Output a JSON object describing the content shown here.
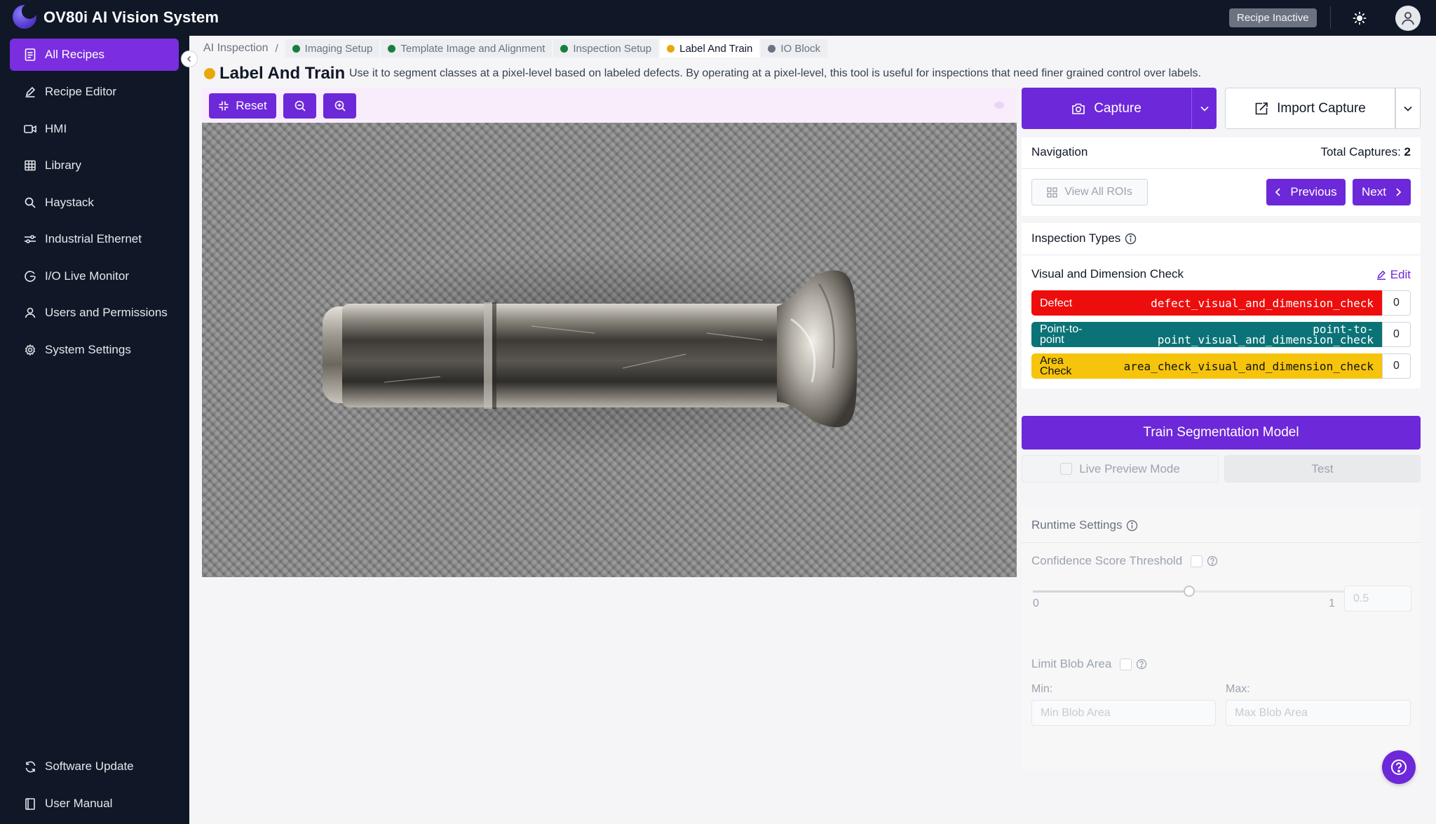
{
  "app": {
    "title": "OV80i AI Vision System",
    "status": "Recipe Inactive"
  },
  "sidebar": {
    "items": [
      {
        "label": "All Recipes",
        "icon": "document-list-icon",
        "active": true
      },
      {
        "label": "Recipe Editor",
        "icon": "pencil-icon"
      },
      {
        "label": "HMI",
        "icon": "video-icon"
      },
      {
        "label": "Library",
        "icon": "grid-table-icon"
      },
      {
        "label": "Haystack",
        "icon": "search-icon"
      },
      {
        "label": "Industrial Ethernet",
        "icon": "network-icon"
      },
      {
        "label": "I/O Live Monitor",
        "icon": "monitor-icon"
      },
      {
        "label": "Users and Permissions",
        "icon": "user-icon"
      },
      {
        "label": "System Settings",
        "icon": "gear-icon"
      }
    ],
    "bottom": [
      {
        "label": "Software Update",
        "icon": "refresh-icon"
      },
      {
        "label": "User Manual",
        "icon": "book-icon"
      }
    ]
  },
  "breadcrumb": {
    "root": "AI Inspection",
    "separator": "/",
    "steps": [
      {
        "label": "Imaging Setup",
        "status_color": "#15803d"
      },
      {
        "label": "Template Image and Alignment",
        "status_color": "#15803d"
      },
      {
        "label": "Inspection Setup",
        "status_color": "#15803d"
      },
      {
        "label": "Label And Train",
        "status_color": "#e8a80c",
        "current": true
      },
      {
        "label": "IO Block",
        "status_color": "#6b7280"
      }
    ]
  },
  "page": {
    "title": "Label And Train",
    "description": "Use it to segment classes at a pixel-level based on labeled defects. By operating at a pixel-level, this tool is useful for inspections that need finer grained control over labels."
  },
  "viewer": {
    "reset_label": "Reset"
  },
  "capture": {
    "capture_label": "Capture",
    "import_label": "Import Capture"
  },
  "navigation": {
    "title": "Navigation",
    "total_label": "Total Captures:",
    "total_value": "2",
    "view_all_label": "View All ROIs",
    "previous_label": "Previous",
    "next_label": "Next"
  },
  "inspection_types": {
    "title": "Inspection Types",
    "group_name": "Visual and Dimension Check",
    "edit_label": "Edit",
    "types": [
      {
        "name": "Defect",
        "key": "defect_visual_and_dimension_check",
        "count": "0",
        "color": "#ee0d0d"
      },
      {
        "name": "Point-to-point",
        "key": "point-to-point_visual_and_dimension_check",
        "count": "0",
        "color": "#0b7377"
      },
      {
        "name": "Area Check",
        "key": "area_check_visual_and_dimension_check",
        "count": "0",
        "color": "#f6c40c"
      }
    ]
  },
  "actions": {
    "train_label": "Train Segmentation Model",
    "live_preview_label": "Live Preview Mode",
    "test_label": "Test"
  },
  "runtime": {
    "title": "Runtime Settings",
    "confidence_label": "Confidence Score Threshold",
    "slider_min": "0",
    "slider_max": "1",
    "slider_value": "0.5",
    "blob_label": "Limit Blob Area",
    "min_label": "Min:",
    "max_label": "Max:",
    "min_placeholder": "Min Blob Area",
    "max_placeholder": "Max Blob Area"
  },
  "colors": {
    "accent": "#6d28d9",
    "sidebar_bg": "#101828"
  }
}
